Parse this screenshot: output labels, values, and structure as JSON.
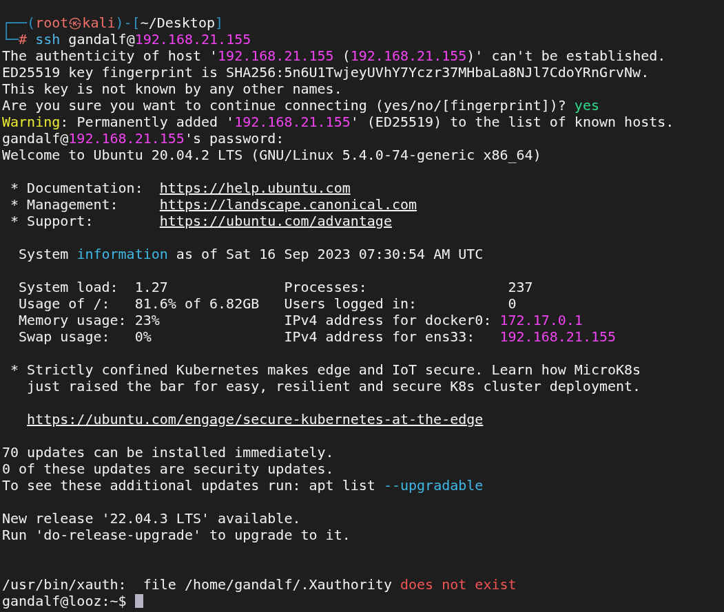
{
  "terminal": {
    "cursor_visible": true,
    "lines": [
      {
        "kind": "text",
        "segments": [
          {
            "text": "┌──(",
            "kind": "prompt"
          },
          {
            "text": "root㉿kali",
            "kind": "user"
          },
          {
            "text": ")-[",
            "kind": "prompt"
          },
          {
            "text": "~/Desktop",
            "kind": "plain"
          },
          {
            "text": "]",
            "kind": "prompt"
          }
        ]
      },
      {
        "kind": "text",
        "segments": [
          {
            "text": "└─",
            "kind": "prompt"
          },
          {
            "text": "#",
            "kind": "user"
          },
          {
            "text": " ssh",
            "kind": "command"
          },
          {
            "text": " gandalf@",
            "kind": "plain"
          },
          {
            "text": "192.168.21.155",
            "kind": "magenta"
          }
        ]
      },
      {
        "kind": "text",
        "segments": [
          {
            "text": "The authenticity of host '",
            "kind": "plain"
          },
          {
            "text": "192.168.21.155",
            "kind": "magenta"
          },
          {
            "text": " (",
            "kind": "plain"
          },
          {
            "text": "192.168.21.155",
            "kind": "magenta"
          },
          {
            "text": ")' can't be established.",
            "kind": "plain"
          }
        ]
      },
      {
        "kind": "text",
        "segments": [
          {
            "text": "ED25519 key fingerprint is SHA256:5n6U1TwjeyUVhY7Yczr37MHbaLa8NJl7CdoYRnGrvNw.",
            "kind": "plain"
          }
        ]
      },
      {
        "kind": "text",
        "segments": [
          {
            "text": "This key is not known by any other names.",
            "kind": "plain"
          }
        ]
      },
      {
        "kind": "text",
        "segments": [
          {
            "text": "Are you sure you want to continue connecting (yes/no/[fingerprint])? ",
            "kind": "plain"
          },
          {
            "text": "yes",
            "kind": "green"
          }
        ]
      },
      {
        "kind": "text",
        "segments": [
          {
            "text": "Warning",
            "kind": "yellow"
          },
          {
            "text": ": Permanently added '",
            "kind": "plain"
          },
          {
            "text": "192.168.21.155",
            "kind": "magenta"
          },
          {
            "text": "' (ED25519) to the list of known hosts.",
            "kind": "plain"
          }
        ]
      },
      {
        "kind": "text",
        "segments": [
          {
            "text": "gandalf@",
            "kind": "plain"
          },
          {
            "text": "192.168.21.155",
            "kind": "magenta"
          },
          {
            "text": "'s password:",
            "kind": "plain"
          }
        ]
      },
      {
        "kind": "text",
        "segments": [
          {
            "text": "Welcome to Ubuntu 20.04.2 LTS (GNU/Linux 5.4.0-74-generic x86_64)",
            "kind": "plain"
          }
        ]
      },
      {
        "kind": "blank"
      },
      {
        "kind": "text",
        "segments": [
          {
            "text": " * Documentation:  ",
            "kind": "plain"
          },
          {
            "text": "https://help.ubuntu.com",
            "kind": "link"
          }
        ]
      },
      {
        "kind": "text",
        "segments": [
          {
            "text": " * Management:     ",
            "kind": "plain"
          },
          {
            "text": "https://landscape.canonical.com",
            "kind": "link"
          }
        ]
      },
      {
        "kind": "text",
        "segments": [
          {
            "text": " * Support:        ",
            "kind": "plain"
          },
          {
            "text": "https://ubuntu.com/advantage",
            "kind": "link"
          }
        ]
      },
      {
        "kind": "blank"
      },
      {
        "kind": "text",
        "segments": [
          {
            "text": "  System ",
            "kind": "plain"
          },
          {
            "text": "information",
            "kind": "cyan"
          },
          {
            "text": " as of Sat 16 Sep 2023 07:30:54 AM UTC",
            "kind": "plain"
          }
        ]
      },
      {
        "kind": "blank"
      },
      {
        "kind": "text",
        "segments": [
          {
            "text": "  System load:  1.27              Processes:                 237",
            "kind": "plain"
          }
        ]
      },
      {
        "kind": "text",
        "segments": [
          {
            "text": "  Usage of /:   81.6% of 6.82GB   Users logged in:           0",
            "kind": "plain"
          }
        ]
      },
      {
        "kind": "text",
        "segments": [
          {
            "text": "  Memory usage: 23%               IPv4 address for docker0: ",
            "kind": "plain"
          },
          {
            "text": "172.17.0.1",
            "kind": "magenta"
          }
        ]
      },
      {
        "kind": "text",
        "segments": [
          {
            "text": "  Swap usage:   0%                IPv4 address for ens33:   ",
            "kind": "plain"
          },
          {
            "text": "192.168.21.155",
            "kind": "magenta"
          }
        ]
      },
      {
        "kind": "blank"
      },
      {
        "kind": "text",
        "segments": [
          {
            "text": " * Strictly confined Kubernetes makes edge and IoT secure. Learn how MicroK8s",
            "kind": "plain"
          }
        ]
      },
      {
        "kind": "text",
        "segments": [
          {
            "text": "   just raised the bar for easy, resilient and secure K8s cluster deployment.",
            "kind": "plain"
          }
        ]
      },
      {
        "kind": "blank"
      },
      {
        "kind": "indented",
        "segments": [
          {
            "text": "https://ubuntu.com/engage/secure-kubernetes-at-the-edge",
            "kind": "link"
          }
        ]
      },
      {
        "kind": "blank"
      },
      {
        "kind": "text",
        "segments": [
          {
            "text": "70 updates can be installed immediately.",
            "kind": "plain"
          }
        ]
      },
      {
        "kind": "text",
        "segments": [
          {
            "text": "0 of these updates are security updates.",
            "kind": "plain"
          }
        ]
      },
      {
        "kind": "text",
        "segments": [
          {
            "text": "To see these additional updates run: apt list ",
            "kind": "plain"
          },
          {
            "text": "--upgradable",
            "kind": "cyan"
          }
        ]
      },
      {
        "kind": "blank"
      },
      {
        "kind": "text",
        "segments": [
          {
            "text": "New release '22.04.3 LTS' available.",
            "kind": "plain"
          }
        ]
      },
      {
        "kind": "text",
        "segments": [
          {
            "text": "Run 'do-release-upgrade' to upgrade to it.",
            "kind": "plain"
          }
        ]
      },
      {
        "kind": "blank"
      },
      {
        "kind": "blank"
      },
      {
        "kind": "text",
        "segments": [
          {
            "text": "/usr/bin/xauth:  file /home/gandalf/.Xauthority ",
            "kind": "plain"
          },
          {
            "text": "does not exist",
            "kind": "red"
          }
        ]
      },
      {
        "kind": "text",
        "segments": [
          {
            "text": "gandalf@looz:~$ ",
            "kind": "plain"
          }
        ]
      }
    ]
  }
}
